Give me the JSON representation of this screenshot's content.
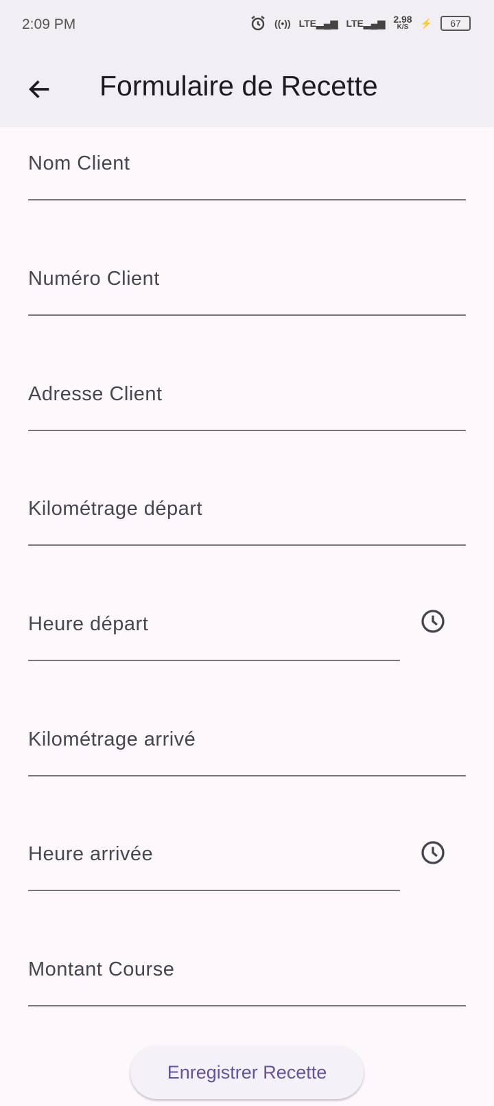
{
  "status_bar": {
    "time": "2:09 PM",
    "net1": "LTE",
    "net2": "LTE",
    "speed": "2.98",
    "speed_unit": "K/S",
    "battery": "67"
  },
  "app_bar": {
    "title": "Formulaire de Recette"
  },
  "form": {
    "fields": [
      {
        "label": "Nom Client"
      },
      {
        "label": "Numéro Client"
      },
      {
        "label": "Adresse Client"
      },
      {
        "label": "Kilométrage départ"
      },
      {
        "label": "Heure départ"
      },
      {
        "label": "Kilométrage arrivé"
      },
      {
        "label": "Heure arrivée"
      },
      {
        "label": "Montant Course"
      }
    ],
    "submit_label": "Enregistrer Recette"
  },
  "colors": {
    "accent": "#65539e",
    "app_bar": "#f2eff4",
    "background": "#fdf8fc"
  }
}
